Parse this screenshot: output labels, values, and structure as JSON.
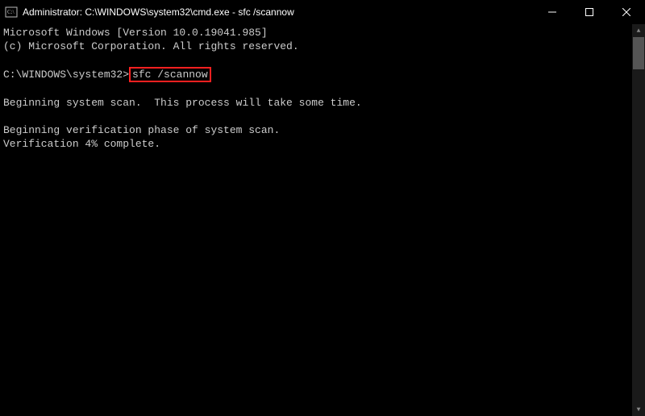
{
  "titlebar": {
    "title": "Administrator: C:\\WINDOWS\\system32\\cmd.exe - sfc  /scannow"
  },
  "terminal": {
    "line1": "Microsoft Windows [Version 10.0.19041.985]",
    "line2": "(c) Microsoft Corporation. All rights reserved.",
    "blank": " ",
    "prompt_prefix": "C:\\WINDOWS\\system32>",
    "command": "sfc /scannow",
    "line4": "Beginning system scan.  This process will take some time.",
    "line5": "Beginning verification phase of system scan.",
    "line6": "Verification 4% complete."
  }
}
